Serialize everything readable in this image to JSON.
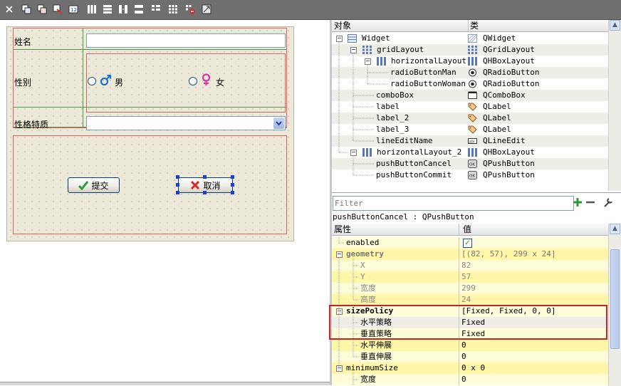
{
  "form": {
    "label_name": "姓名",
    "label_gender": "性别",
    "label_trait": "性格特质",
    "radio_male": "男",
    "radio_female": "女",
    "submit_button": "提交",
    "cancel_button": "取消"
  },
  "object_inspector": {
    "col_object": "对象",
    "col_class": "类",
    "rows": [
      {
        "name": "Widget",
        "cls": "QWidget"
      },
      {
        "name": "gridLayout",
        "cls": "QGridLayout"
      },
      {
        "name": "horizontalLayout",
        "cls": "QHBoxLayout"
      },
      {
        "name": "radioButtonMan",
        "cls": "QRadioButton"
      },
      {
        "name": "radioButtonWoman",
        "cls": "QRadioButton"
      },
      {
        "name": "comboBox",
        "cls": "QComboBox"
      },
      {
        "name": "label",
        "cls": "QLabel"
      },
      {
        "name": "label_2",
        "cls": "QLabel"
      },
      {
        "name": "label_3",
        "cls": "QLabel"
      },
      {
        "name": "lineEditName",
        "cls": "QLineEdit"
      },
      {
        "name": "horizontalLayout_2",
        "cls": "QHBoxLayout"
      },
      {
        "name": "pushButtonCancel",
        "cls": "QPushButton"
      },
      {
        "name": "pushButtonCommit",
        "cls": "QPushButton"
      }
    ]
  },
  "property_editor": {
    "filter_placeholder": "Filter",
    "object_title": "pushButtonCancel : QPushButton",
    "col_property": "属性",
    "col_value": "值",
    "rows": [
      {
        "name": "enabled",
        "value": "✓"
      },
      {
        "name": "geometry",
        "value": "[(82, 57), 299 x 24]"
      },
      {
        "name": "X",
        "value": "82"
      },
      {
        "name": "Y",
        "value": "57"
      },
      {
        "name": "宽度",
        "value": "299"
      },
      {
        "name": "高度",
        "value": "24"
      },
      {
        "name": "sizePolicy",
        "value": "[Fixed, Fixed, 0, 0]"
      },
      {
        "name": "水平策略",
        "value": "Fixed"
      },
      {
        "name": "垂直策略",
        "value": "Fixed"
      },
      {
        "name": "水平伸展",
        "value": "0"
      },
      {
        "name": "垂直伸展",
        "value": "0"
      },
      {
        "name": "minimumSize",
        "value": "0 x 0"
      },
      {
        "name": "宽度",
        "value": "0"
      }
    ]
  },
  "colors": {
    "highlight_box": "#c0262b",
    "grid_line": "#4a9a4a",
    "layout_box": "#e06060",
    "selection_handle": "#1c3fd6"
  }
}
